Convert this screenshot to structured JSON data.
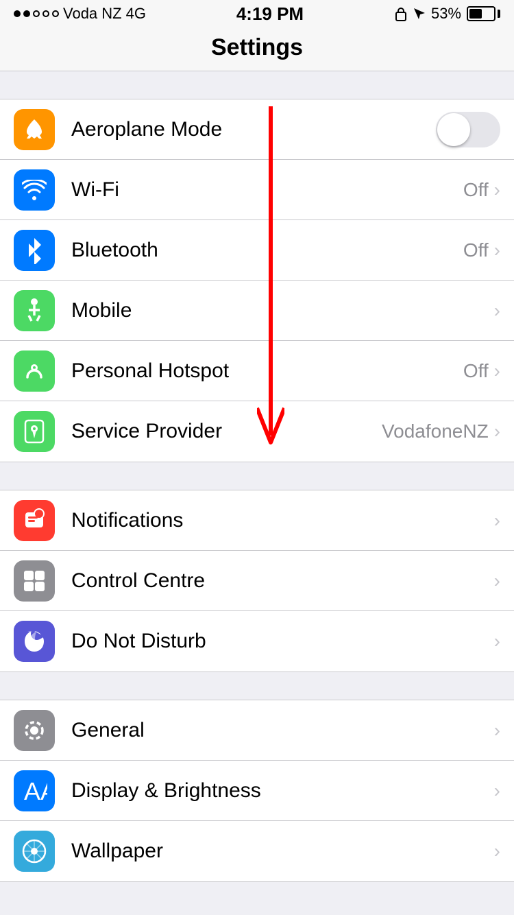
{
  "statusBar": {
    "carrier": "Voda NZ",
    "networkType": "4G",
    "time": "4:19 PM",
    "batteryPercent": "53%"
  },
  "header": {
    "title": "Settings"
  },
  "sections": [
    {
      "id": "connectivity",
      "rows": [
        {
          "id": "aeroplane-mode",
          "label": "Aeroplane Mode",
          "iconBg": "bg-orange",
          "iconType": "plane",
          "rightType": "toggle",
          "rightValue": "off",
          "chevron": false
        },
        {
          "id": "wifi",
          "label": "Wi-Fi",
          "iconBg": "bg-blue",
          "iconType": "wifi",
          "rightType": "text",
          "rightValue": "Off",
          "chevron": true
        },
        {
          "id": "bluetooth",
          "label": "Bluetooth",
          "iconBg": "bg-blue-dark",
          "iconType": "bluetooth",
          "rightType": "text",
          "rightValue": "Off",
          "chevron": true
        },
        {
          "id": "mobile",
          "label": "Mobile",
          "iconBg": "bg-green",
          "iconType": "mobile",
          "rightType": "none",
          "rightValue": "",
          "chevron": true
        },
        {
          "id": "personal-hotspot",
          "label": "Personal Hotspot",
          "iconBg": "bg-green-dark",
          "iconType": "hotspot",
          "rightType": "text",
          "rightValue": "Off",
          "chevron": true
        },
        {
          "id": "service-provider",
          "label": "Service Provider",
          "iconBg": "bg-green-dark",
          "iconType": "phone",
          "rightType": "text",
          "rightValue": "VodafoneNZ",
          "chevron": true
        }
      ]
    },
    {
      "id": "system",
      "rows": [
        {
          "id": "notifications",
          "label": "Notifications",
          "iconBg": "bg-red",
          "iconType": "notifications",
          "rightType": "none",
          "rightValue": "",
          "chevron": true
        },
        {
          "id": "control-centre",
          "label": "Control Centre",
          "iconBg": "bg-gray",
          "iconType": "control-centre",
          "rightType": "none",
          "rightValue": "",
          "chevron": true
        },
        {
          "id": "do-not-disturb",
          "label": "Do Not Disturb",
          "iconBg": "bg-purple",
          "iconType": "moon",
          "rightType": "none",
          "rightValue": "",
          "chevron": true
        }
      ]
    },
    {
      "id": "preferences",
      "rows": [
        {
          "id": "general",
          "label": "General",
          "iconBg": "bg-gray",
          "iconType": "gear",
          "rightType": "none",
          "rightValue": "",
          "chevron": true
        },
        {
          "id": "display-brightness",
          "label": "Display & Brightness",
          "iconBg": "bg-blue",
          "iconType": "display",
          "rightType": "none",
          "rightValue": "",
          "chevron": true
        },
        {
          "id": "wallpaper",
          "label": "Wallpaper",
          "iconBg": "bg-teal",
          "iconType": "wallpaper",
          "rightType": "none",
          "rightValue": "",
          "chevron": true
        }
      ]
    }
  ]
}
